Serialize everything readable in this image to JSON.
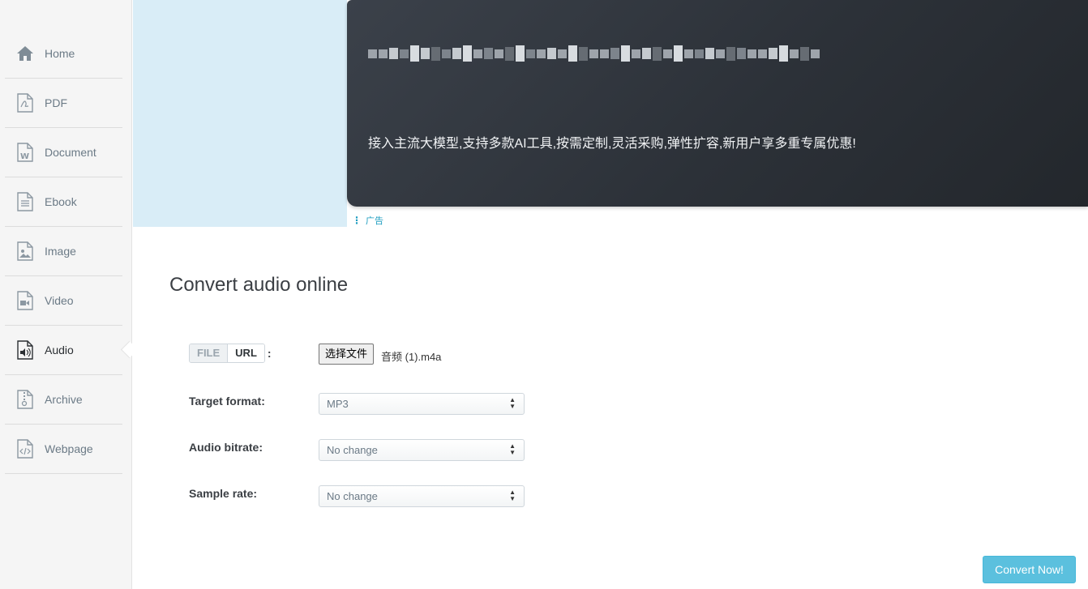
{
  "sidebar": {
    "items": [
      {
        "label": "Home",
        "icon": "home-icon"
      },
      {
        "label": "PDF",
        "icon": "pdf-file-icon"
      },
      {
        "label": "Document",
        "icon": "word-document-icon"
      },
      {
        "label": "Ebook",
        "icon": "ebook-file-icon"
      },
      {
        "label": "Image",
        "icon": "image-file-icon"
      },
      {
        "label": "Video",
        "icon": "video-file-icon"
      },
      {
        "label": "Audio",
        "icon": "audio-file-icon",
        "active": true
      },
      {
        "label": "Archive",
        "icon": "archive-file-icon"
      },
      {
        "label": "Webpage",
        "icon": "webpage-file-icon"
      }
    ]
  },
  "ad": {
    "text": "接入主流大模型,支持多款AI工具,按需定制,灵活采购,弹性扩容,新用户享多重专属优惠!",
    "tag": "广告"
  },
  "main": {
    "title": "Convert audio online",
    "source_toggle": {
      "file": "FILE",
      "url": "URL",
      "suffix": ":"
    },
    "file_button": "选择文件",
    "file_name": "音频 (1).m4a",
    "fields": [
      {
        "label": "Target format:",
        "value": "MP3"
      },
      {
        "label": "Audio bitrate:",
        "value": "No change"
      },
      {
        "label": "Sample rate:",
        "value": "No change"
      }
    ],
    "convert_button": "Convert Now!"
  },
  "colors": {
    "accent": "#5bc0de",
    "sidebar_bg": "#f5f5f5",
    "ad_left_bg": "#d9edf7",
    "ad_banner_bg": "#2c3138"
  }
}
